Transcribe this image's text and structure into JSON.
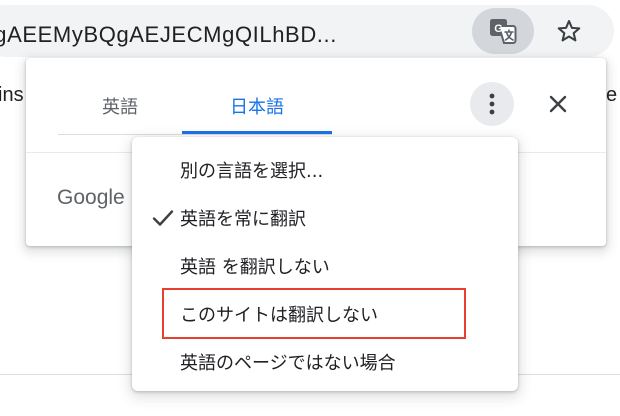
{
  "toolbar": {
    "url": "AgAEEMyBQgAEJECMgQILhBD..."
  },
  "background_page": {
    "left_fragment": "ins",
    "right_fragment": "e"
  },
  "translate_bubble": {
    "tabs": [
      {
        "label": "英語",
        "selected": false
      },
      {
        "label": "日本語",
        "selected": true
      }
    ],
    "branding": "Google"
  },
  "options_menu": {
    "items": [
      {
        "label": "別の言語を選択...",
        "checked": false
      },
      {
        "label": "英語を常に翻訳",
        "checked": true
      },
      {
        "label": "英語 を翻訳しない",
        "checked": false
      },
      {
        "label": "このサイトは翻訳しない",
        "checked": false,
        "highlighted": true
      },
      {
        "label": "英語のページではない場合",
        "checked": false
      }
    ]
  },
  "colors": {
    "accent": "#1a73e8",
    "highlight_border": "#e8402f"
  }
}
